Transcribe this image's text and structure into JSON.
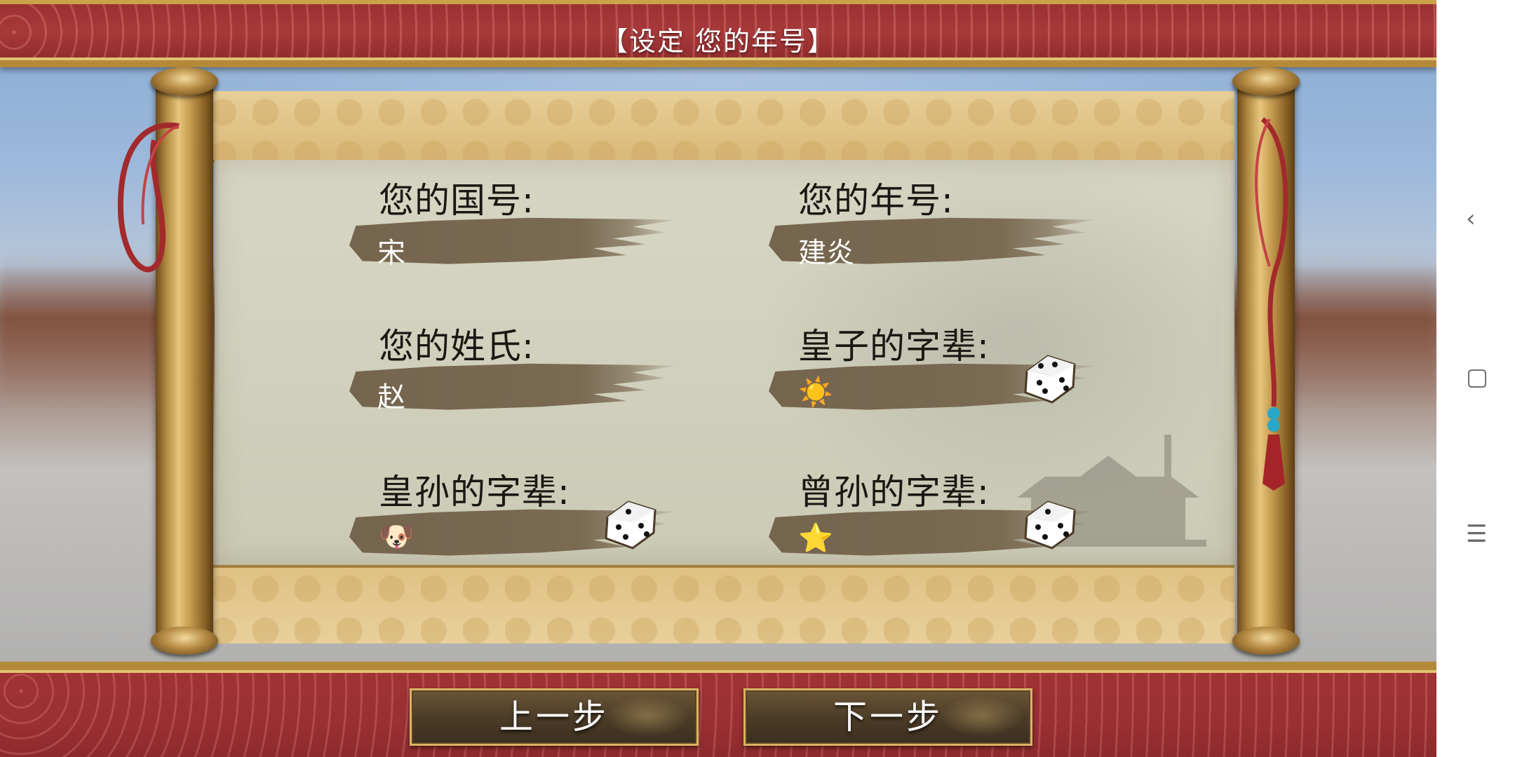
{
  "title": "【设定 您的年号】",
  "fields": {
    "country": {
      "label": "您的国号:",
      "value": "宋"
    },
    "era": {
      "label": "您的年号:",
      "value": "建炎"
    },
    "surname": {
      "label": "您的姓氏:",
      "value": "赵"
    },
    "prince_generation": {
      "label": "皇子的字辈:",
      "value": "☀️"
    },
    "grandson_generation": {
      "label": "皇孙的字辈:",
      "value": "🐶"
    },
    "great_grandson_generation": {
      "label": "曾孙的字辈:",
      "value": "⭐"
    }
  },
  "buttons": {
    "prev": "上一步",
    "next": "下一步"
  },
  "android_nav": {
    "back": "‹",
    "home": "▢",
    "menu": "☰"
  },
  "colors": {
    "banner_red": "#9c3133",
    "gold": "#d8b560",
    "ink_brush": "#75654e"
  }
}
